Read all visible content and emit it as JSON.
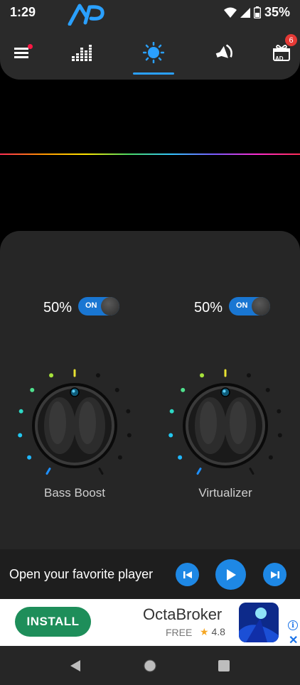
{
  "status": {
    "time": "1:29",
    "battery": "35%"
  },
  "nav": {
    "items": [
      {
        "name": "menu",
        "icon": "menu-icon"
      },
      {
        "name": "equalizer",
        "icon": "equalizer-bars-icon"
      },
      {
        "name": "bass-virtualizer",
        "icon": "sun-knob-icon",
        "active": true
      },
      {
        "name": "volume",
        "icon": "speaker-icon"
      },
      {
        "name": "ads",
        "icon": "gift-ad-icon",
        "badge": "6"
      }
    ],
    "gift_label": "AD",
    "accent": "#2aa0ff"
  },
  "controls": {
    "bass": {
      "percent": "50%",
      "toggle": "ON",
      "label": "Bass Boost",
      "level": 0.5
    },
    "virtualizer": {
      "percent": "50%",
      "toggle": "ON",
      "label": "Virtualizer",
      "level": 0.5
    }
  },
  "player": {
    "text": "Open your favorite player"
  },
  "ad": {
    "install": "INSTALL",
    "title": "OctaBroker",
    "price": "FREE",
    "rating": "4.8",
    "star": "★",
    "info": "i",
    "close": "✕"
  }
}
